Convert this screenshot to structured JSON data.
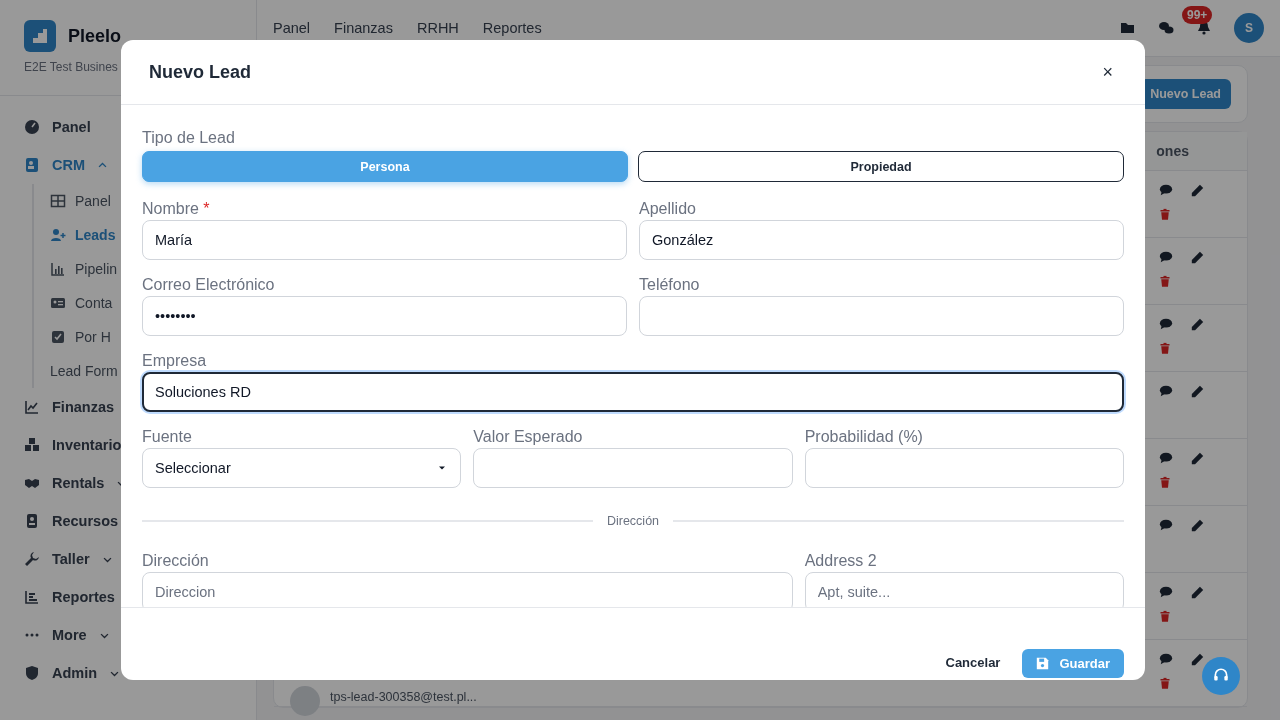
{
  "sidebar": {
    "brand": "Pleelo",
    "business": "E2E Test Busines",
    "items": [
      {
        "label": "Panel",
        "selected": false
      },
      {
        "label": "CRM",
        "selected": true,
        "expanded": true,
        "children": [
          {
            "label": "Panel",
            "selected": false
          },
          {
            "label": "Leads",
            "selected": true
          },
          {
            "label": "Pipelin",
            "selected": false
          },
          {
            "label": "Conta",
            "selected": false
          },
          {
            "label": "Por H",
            "selected": false
          },
          {
            "label": "Lead Form",
            "selected": false
          }
        ]
      },
      {
        "label": "Finanzas",
        "selected": false
      },
      {
        "label": "Inventario",
        "selected": false
      },
      {
        "label": "Rentals",
        "selected": false,
        "expanded": false
      },
      {
        "label": "Recursos",
        "selected": false
      },
      {
        "label": "Taller",
        "selected": false,
        "expanded": false
      },
      {
        "label": "Reportes",
        "selected": false
      },
      {
        "label": "More",
        "selected": false,
        "expanded": false
      },
      {
        "label": "Admin",
        "selected": false,
        "expanded": false
      }
    ]
  },
  "topnav": {
    "links": [
      "Panel",
      "Finanzas",
      "RRHH",
      "Reportes"
    ],
    "notification_count": "99+",
    "avatar": "S"
  },
  "page": {
    "new_button": "Nuevo Lead",
    "table": {
      "column_header": "ones",
      "rows": [
        {
          "deletable": true
        },
        {
          "deletable": true
        },
        {
          "deletable": true
        },
        {
          "deletable": false
        },
        {
          "deletable": true
        },
        {
          "deletable": false
        },
        {
          "deletable": true
        },
        {
          "deletable": true,
          "email": "tps-lead-300358@test.pl..."
        }
      ]
    }
  },
  "modal": {
    "title": "Nuevo Lead",
    "close": "×",
    "lead_type": {
      "label": "Tipo de Lead",
      "options": [
        {
          "label": "Persona",
          "selected": true
        },
        {
          "label": "Propiedad",
          "selected": false
        }
      ]
    },
    "rows": [
      [
        {
          "kind": "text",
          "label": "Nombre",
          "required_mark": "*",
          "value": "María"
        },
        {
          "kind": "text",
          "label": "Apellido",
          "value": "González"
        }
      ],
      [
        {
          "kind": "text",
          "label": "Correo Electrónico",
          "value": "••••••••"
        },
        {
          "kind": "text",
          "label": "Teléfono"
        }
      ],
      [
        {
          "kind": "text",
          "label": "Empresa",
          "value": "Soluciones RD",
          "focused": true
        }
      ],
      [
        {
          "kind": "select",
          "label": "Fuente",
          "value": "Seleccionar"
        },
        {
          "kind": "text",
          "label": "Valor Esperado"
        },
        {
          "kind": "text",
          "label": "Probabilidad (%)"
        }
      ]
    ],
    "section": "Dirección",
    "address_row": [
      {
        "kind": "text",
        "label": "Dirección",
        "placeholder": "Direccion",
        "wide": true
      },
      {
        "kind": "text",
        "label": "Address 2",
        "placeholder": "Apt, suite..."
      }
    ],
    "cancel": "Cancelar",
    "save": "Guardar"
  }
}
